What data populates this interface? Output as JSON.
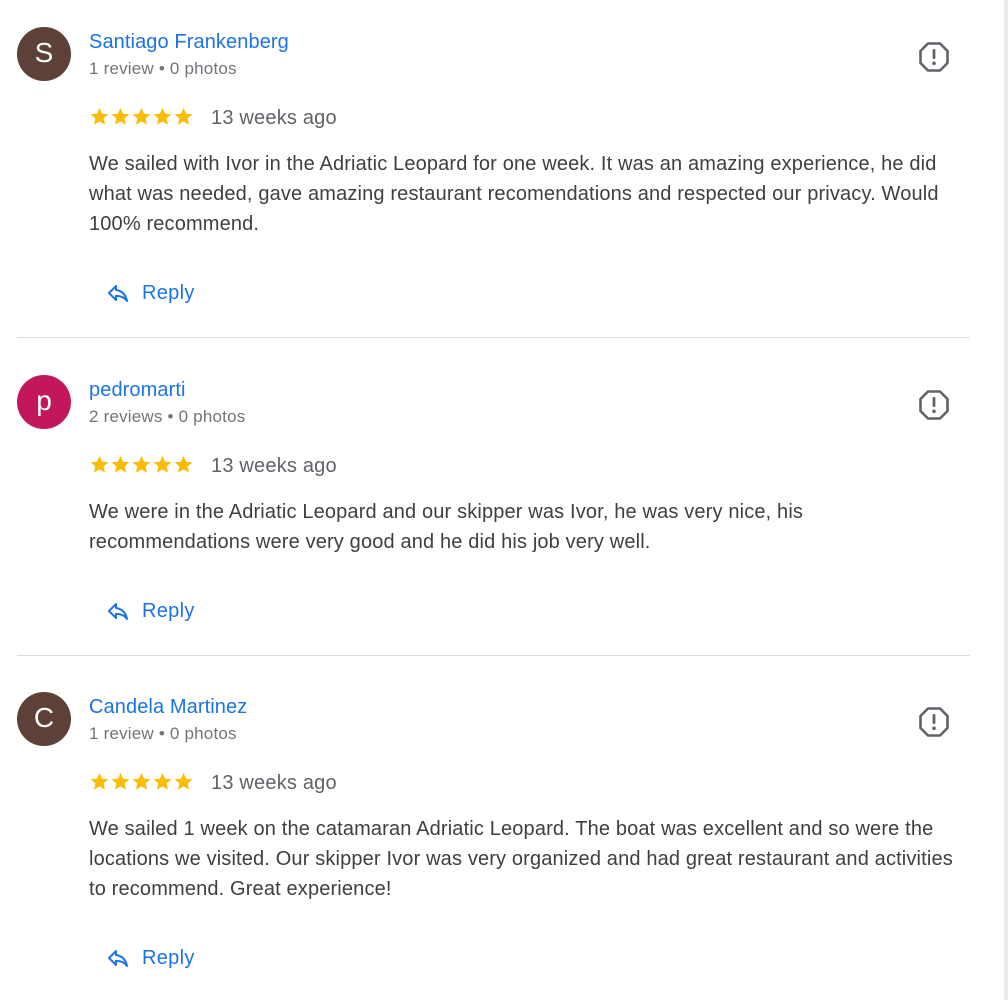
{
  "reviews": [
    {
      "avatar_letter": "S",
      "avatar_color": "#5d4037",
      "name": "Santiago Frankenberg",
      "meta": "1 review • 0 photos",
      "rating": 5,
      "time": "13 weeks ago",
      "text": "We sailed with Ivor in the Adriatic Leopard for one week. It was an amazing experience, he did what was needed, gave amazing restaurant recomendations and respected our privacy. Would 100% recommend.",
      "reply_label": "Reply",
      "report_icon": "report-icon"
    },
    {
      "avatar_letter": "p",
      "avatar_color": "#c2185b",
      "name": "pedromarti",
      "meta": "2 reviews • 0 photos",
      "rating": 5,
      "time": "13 weeks ago",
      "text": "We were in the Adriatic Leopard and our skipper was Ivor, he was very nice, his recommendations were very good and he did his job very well.",
      "reply_label": "Reply",
      "report_icon": "report-icon"
    },
    {
      "avatar_letter": "C",
      "avatar_color": "#5d4037",
      "name": "Candela Martinez",
      "meta": "1 review • 0 photos",
      "rating": 5,
      "time": "13 weeks ago",
      "text": "We sailed 1 week on the catamaran Adriatic Leopard. The boat was excellent and so were the locations we visited. Our skipper Ivor was very organized and had great restaurant and activities to recommend. Great experience!",
      "reply_label": "Reply",
      "report_icon": "report-icon"
    }
  ],
  "colors": {
    "link": "#1a73e8",
    "star": "#fbbc04",
    "text": "#3c4043",
    "muted": "#70757a"
  }
}
